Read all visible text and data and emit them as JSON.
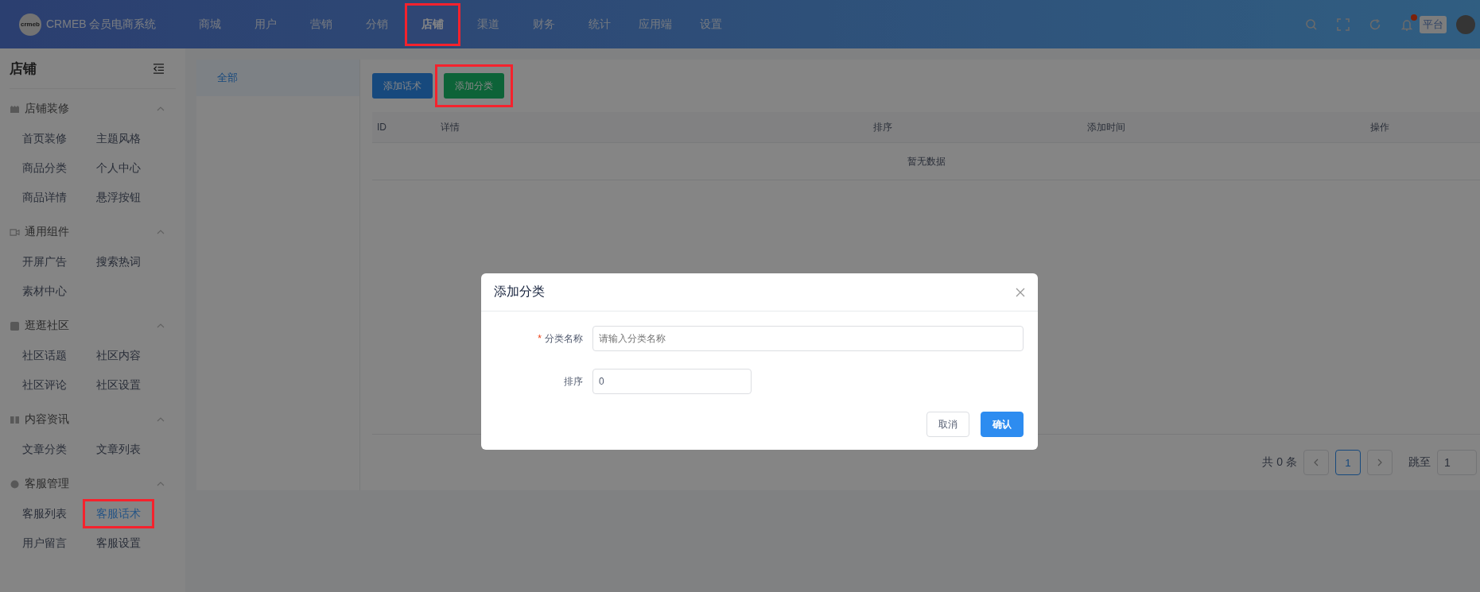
{
  "header": {
    "logo_mark": "crmeb",
    "brand": "CRMEB 会员电商系统",
    "nav": [
      {
        "label": "商城",
        "selected": false,
        "highlighted": false
      },
      {
        "label": "用户",
        "selected": false,
        "highlighted": false
      },
      {
        "label": "营销",
        "selected": false,
        "highlighted": false
      },
      {
        "label": "分销",
        "selected": false,
        "highlighted": false
      },
      {
        "label": "店铺",
        "selected": true,
        "highlighted": true
      },
      {
        "label": "渠道",
        "selected": false,
        "highlighted": false
      },
      {
        "label": "财务",
        "selected": false,
        "highlighted": false
      },
      {
        "label": "统计",
        "selected": false,
        "highlighted": false
      },
      {
        "label": "应用端",
        "selected": false,
        "highlighted": false
      },
      {
        "label": "设置",
        "selected": false,
        "highlighted": false
      }
    ],
    "notification_dot": true,
    "role_badge": "平台"
  },
  "sidebar": {
    "title": "店铺",
    "groups": [
      {
        "title": "店铺装修",
        "expanded": true,
        "items": [
          {
            "label": "首页装修",
            "selected": false,
            "highlighted": false
          },
          {
            "label": "主题风格",
            "selected": false,
            "highlighted": false
          },
          {
            "label": "商品分类",
            "selected": false,
            "highlighted": false
          },
          {
            "label": "个人中心",
            "selected": false,
            "highlighted": false
          },
          {
            "label": "商品详情",
            "selected": false,
            "highlighted": false
          },
          {
            "label": "悬浮按钮",
            "selected": false,
            "highlighted": false
          }
        ]
      },
      {
        "title": "通用组件",
        "expanded": true,
        "items": [
          {
            "label": "开屏广告",
            "selected": false,
            "highlighted": false
          },
          {
            "label": "搜索热词",
            "selected": false,
            "highlighted": false
          },
          {
            "label": "素材中心",
            "selected": false,
            "highlighted": false
          }
        ]
      },
      {
        "title": "逛逛社区",
        "expanded": true,
        "items": [
          {
            "label": "社区话题",
            "selected": false,
            "highlighted": false
          },
          {
            "label": "社区内容",
            "selected": false,
            "highlighted": false
          },
          {
            "label": "社区评论",
            "selected": false,
            "highlighted": false
          },
          {
            "label": "社区设置",
            "selected": false,
            "highlighted": false
          }
        ]
      },
      {
        "title": "内容资讯",
        "expanded": true,
        "items": [
          {
            "label": "文章分类",
            "selected": false,
            "highlighted": false
          },
          {
            "label": "文章列表",
            "selected": false,
            "highlighted": false
          }
        ]
      },
      {
        "title": "客服管理",
        "expanded": true,
        "items": [
          {
            "label": "客服列表",
            "selected": false,
            "highlighted": false
          },
          {
            "label": "客服话术",
            "selected": true,
            "highlighted": true
          },
          {
            "label": "用户留言",
            "selected": false,
            "highlighted": false
          },
          {
            "label": "客服设置",
            "selected": false,
            "highlighted": false
          }
        ]
      }
    ]
  },
  "categories": [
    {
      "label": "全部",
      "selected": true
    }
  ],
  "toolbar": [
    {
      "label": "添加话术",
      "kind": "primary",
      "highlighted": false
    },
    {
      "label": "添加分类",
      "kind": "success",
      "highlighted": true
    }
  ],
  "table": {
    "columns": [
      "ID",
      "详情",
      "排序",
      "添加时间",
      "操作"
    ],
    "empty_text": "暂无数据"
  },
  "pagination": {
    "total": "共 0 条",
    "pages": [
      {
        "label": "1",
        "selected": true
      }
    ],
    "jump_label": "跳至",
    "jump_value": "1"
  },
  "dialog": {
    "title": "添加分类",
    "fields": [
      {
        "required_mark": "*",
        "label": "分类名称",
        "placeholder": "请输入分类名称",
        "wide": true
      },
      {
        "label": "排序",
        "value": "0",
        "wide": false
      }
    ],
    "buttons": [
      {
        "label": "取消",
        "kind": "default"
      },
      {
        "label": "确认",
        "kind": "primary"
      }
    ]
  }
}
